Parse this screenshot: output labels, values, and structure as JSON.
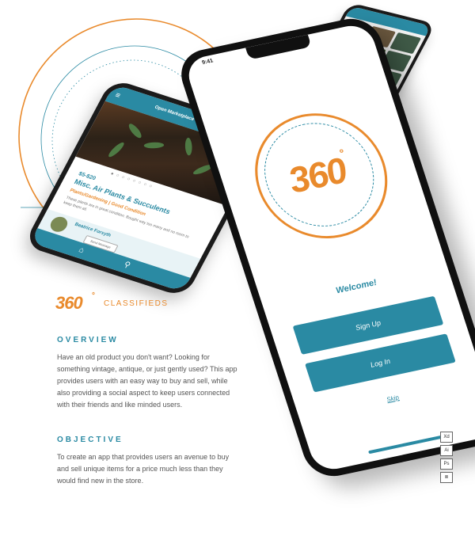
{
  "brand": {
    "number": "360",
    "degree": "°",
    "word": "CLASSIFIEDS"
  },
  "overview": {
    "heading": "OVERVIEW",
    "body": "Have an old product you don't want? Looking for something vintage, antique, or just gently used? This app provides users with an easy way to buy and sell, while also providing a social aspect to keep users connected with their friends and like minded users."
  },
  "objective": {
    "heading": "OBJECTIVE",
    "body": "To create an app that provides users an avenue to buy and sell unique items for a price much less than they would find new in the store."
  },
  "main_phone": {
    "status_time": "9:41",
    "logo": "360",
    "logo_degree": "°",
    "welcome": "Welcome!",
    "signup_label": "Sign Up",
    "login_label": "Log In",
    "skip_label": "Skip"
  },
  "listing_phone": {
    "header_title": "Open Marketplace",
    "price": "$5-$20",
    "title": "Misc. Air Plants & Succulents",
    "category": "Plants/Gardening | Good Condition",
    "description": "These plants are in great condition. Bought way too many and no room to keep them all.",
    "seller_name": "Beatrice Forsyth",
    "seller_button": "Send Message"
  },
  "tools": [
    "Xd",
    "Ai",
    "Ps",
    "≣"
  ],
  "colors": {
    "accent_orange": "#e98a2c",
    "accent_teal": "#2a8aa3",
    "text_gray": "#555555"
  },
  "icons": {
    "menu": "hamburger-icon",
    "home": "home-icon",
    "search": "search-icon"
  }
}
